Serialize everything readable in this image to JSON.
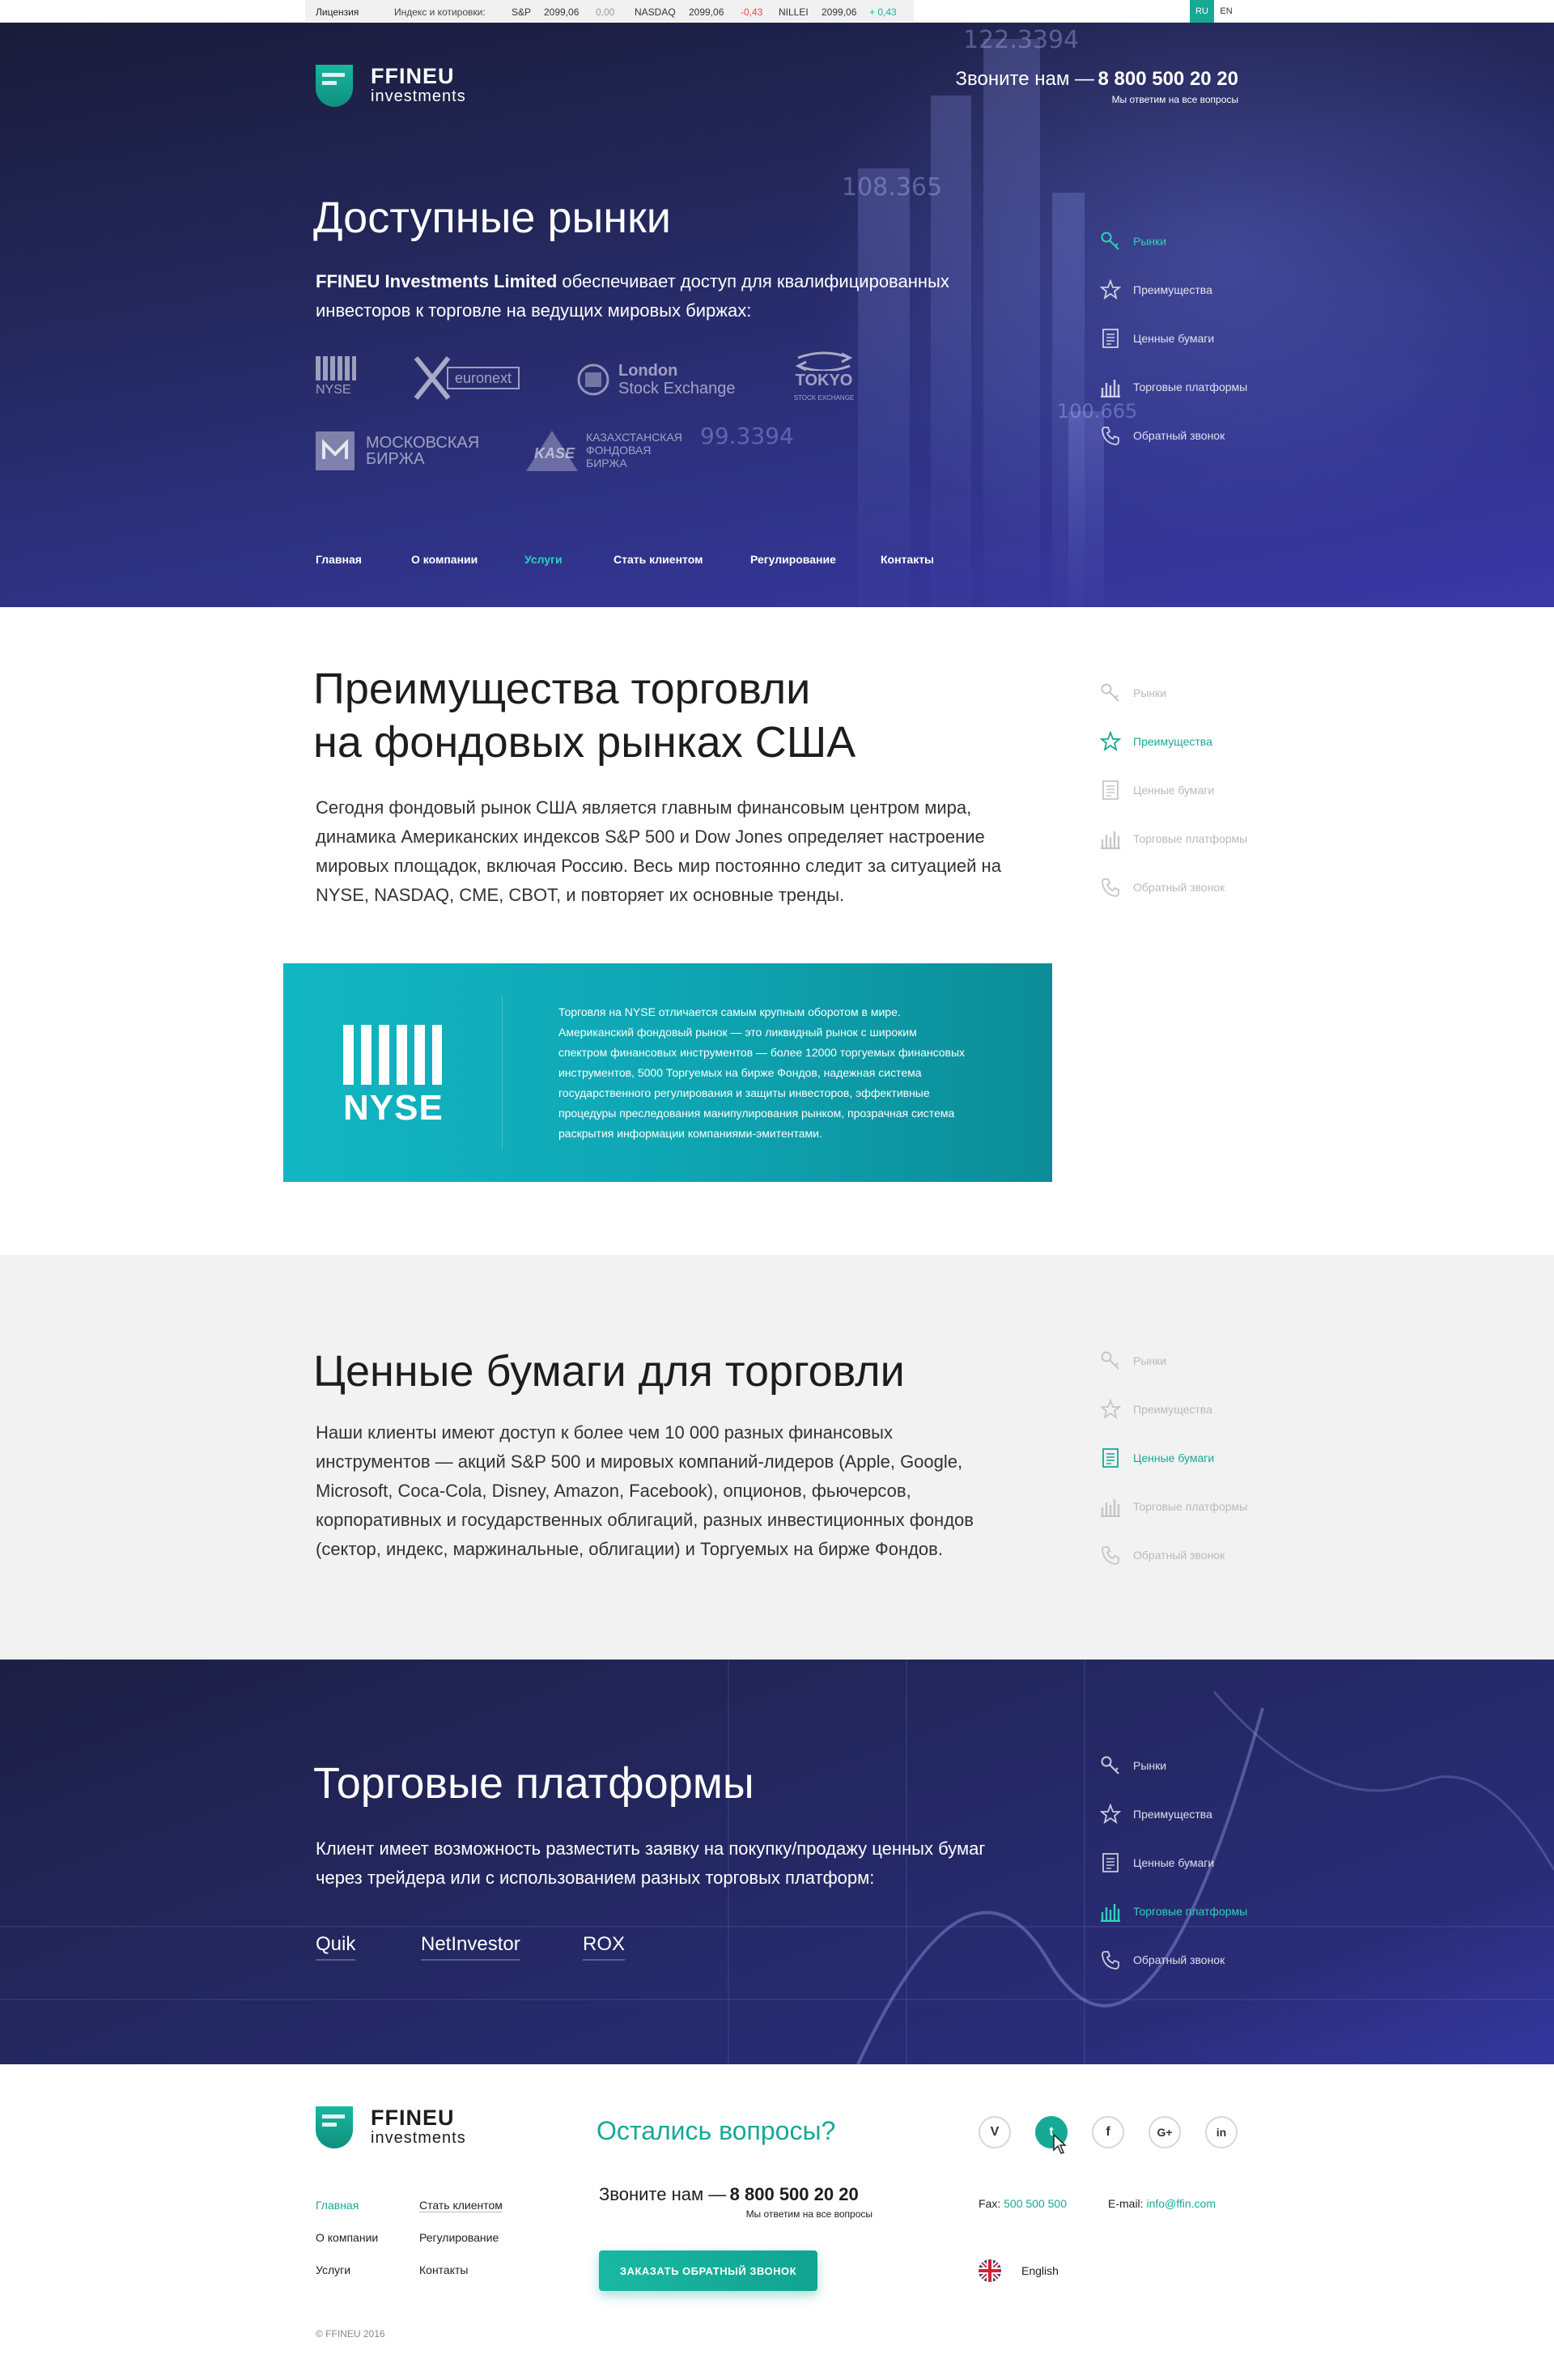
{
  "topbar": {
    "license": "Лицензия",
    "index_label": "Индекс и котировки:",
    "tickers": [
      {
        "name": "S&P",
        "value": "2099,06",
        "change": "0,00"
      },
      {
        "name": "NASDAQ",
        "value": "2099,06",
        "change": "-0,43"
      },
      {
        "name": "NILLEI",
        "value": "2099,06",
        "change": "+ 0,43"
      }
    ],
    "langs": [
      "RU",
      "EN"
    ]
  },
  "brand": {
    "name": "FFINEU",
    "sub": "investments"
  },
  "header": {
    "phone_label": "Звоните нам —",
    "phone": "8 800 500 20 20",
    "phone_note": "Мы ответим на все вопросы"
  },
  "hero": {
    "title": "Доступные рынки",
    "lead_bold": "FFINEU Investments Limited",
    "lead_rest": " обеспечивает доступ для квалифицированных",
    "lead_line2": "инвесторов к торговле на ведущих мировых биржах:",
    "exchanges": [
      "NYSE",
      "euronext",
      "London",
      "Stock Exchange",
      "TOKYO",
      "STOCK EXCHANGE",
      "МОСКОВСКАЯ",
      "БИРЖА",
      "KASE",
      "КАЗАХСТАНСКАЯ",
      "ФОНДОВАЯ",
      "БИРЖА"
    ],
    "bg_numbers": [
      "122.3394",
      "108.365",
      "100.665",
      "99.3394"
    ]
  },
  "nav": [
    "Главная",
    "О компании",
    "Услуги",
    "Стать клиентом",
    "Регулирование",
    "Контакты"
  ],
  "side_menu": [
    "Рынки",
    "Преимущества",
    "Ценные бумаги",
    "Торговые платформы",
    "Обратный звонок"
  ],
  "advantages": {
    "title_1": "Преимущества торговли",
    "title_2": "на фондовых рынках США",
    "text": [
      "Сегодня фондовый рынок США является главным финансовым центром мира,",
      "динамика Американских индексов S&P 500 и Dow Jones определяет настроение",
      "мировых площадок, включая Россию. Весь мир постоянно следит за ситуацией на",
      "NYSE, NASDAQ, CME, CBOT, и повторяет их основные тренды."
    ],
    "nyse_logo": "NYSE",
    "nyse_text": [
      "Торговля на NYSE отличается самым крупным оборотом в мире.",
      "Американский фондовый рынок — это ликвидный рынок с широким",
      "спектром финансовых инструментов — более 12000 торгуемых финансовых",
      "инструментов, 5000 Торгуемых на бирже Фондов, надежная система",
      "государственного регулирования и защиты инвесторов, эффективные",
      "процедуры преследования манипулирования рынком, прозрачная система",
      "раскрытия информации компаниями-эмитентами."
    ]
  },
  "securities": {
    "title": "Ценные бумаги для торговли",
    "text": [
      "Наши клиенты имеют доступ к более чем 10 000 разных финансовых",
      "инструментов — акций S&P 500 и мировых компаний-лидеров (Apple, Google,",
      "Microsoft, Coca-Cola, Disney, Amazon, Facebook), опционов, фьючерсов,",
      "корпоративных и государственных облигаций, разных инвестиционных фондов",
      "(сектор, индекс, маржинальные, облигации) и Торгуемых на бирже Фондов."
    ]
  },
  "platforms": {
    "title": "Торговые платформы",
    "text": [
      "Клиент имеет возможность разместить заявку на покупку/продажу ценных бумаг",
      "через трейдера или с использованием разных торговых платформ:"
    ],
    "items": [
      "Quik",
      "NetInvestor",
      "ROX"
    ]
  },
  "footer": {
    "question": "Остались вопросы?",
    "phone_label": "Звоните нам —",
    "phone": "8 800 500 20 20",
    "phone_note": "Мы ответим на все вопросы",
    "cta": "ЗАКАЗАТЬ ОБРАТНЫЙ ЗВОНОК",
    "socials": [
      "V",
      "t",
      "f",
      "G+",
      "in"
    ],
    "fax_label": "Fax:",
    "fax": "500 500 500",
    "email_label": "E-mail:",
    "email": "info@ffin.com",
    "lang": "English",
    "nav": [
      "Главная",
      "Стать клиентом",
      "О компании",
      "Регулирование",
      "Услуги",
      "Контакты"
    ],
    "copyright": "© FFINEU 2016"
  },
  "colors": {
    "accent": "#17a896",
    "active_nav": "#2fd3b9",
    "negative": "#e04c4c",
    "hero_dark": "#1a1c3a",
    "hero_light": "#3a38a8"
  }
}
